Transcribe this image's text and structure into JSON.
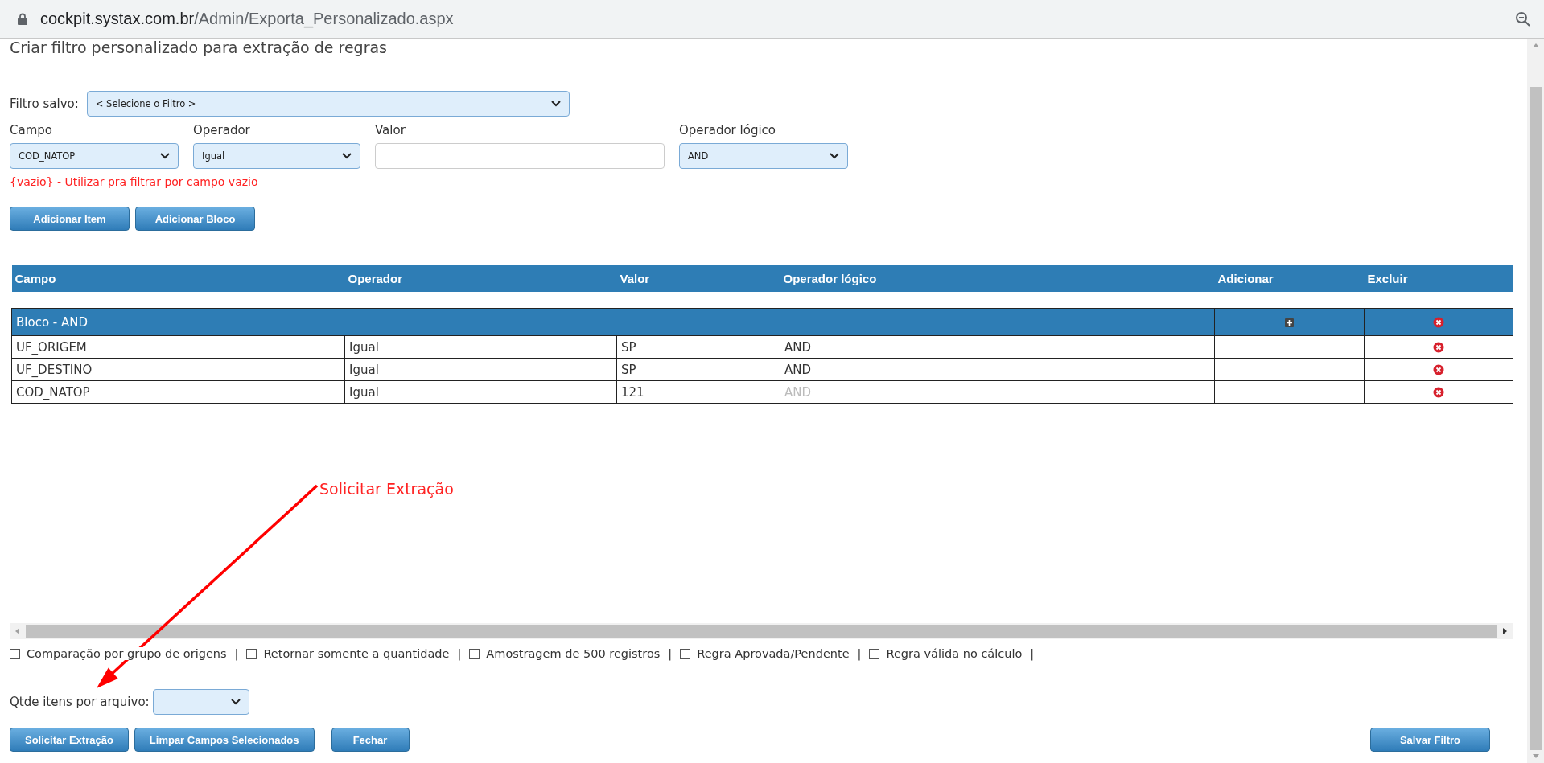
{
  "browser": {
    "url_host": "cockpit.systax.com.br",
    "url_path": "/Admin/Exporta_Personalizado.aspx"
  },
  "title": "Criar filtro personalizado para extração de regras",
  "saved_filter": {
    "label": "Filtro salvo:",
    "value": "< Selecione o Filtro >"
  },
  "fields": [
    {
      "kind": "select",
      "label": "Campo",
      "value": "COD_NATOP"
    },
    {
      "kind": "select",
      "label": "Operador",
      "value": "Igual"
    },
    {
      "kind": "input",
      "label": "Valor"
    },
    {
      "kind": "select",
      "label": "Operador lógico",
      "value": "AND"
    }
  ],
  "hint": "{vazio} - Utilizar pra filtrar por campo vazio",
  "add_buttons": [
    "Adicionar Item",
    "Adicionar Bloco"
  ],
  "table": {
    "columns": [
      "Campo",
      "Operador",
      "Valor",
      "Operador lógico",
      "Adicionar",
      "Excluir"
    ],
    "block": {
      "label": "Bloco - AND"
    },
    "rows": [
      {
        "campo": "UF_ORIGEM",
        "operador": "Igual",
        "valor": "SP",
        "logico": "AND",
        "logico_disabled": false
      },
      {
        "campo": "UF_DESTINO",
        "operador": "Igual",
        "valor": "SP",
        "logico": "AND",
        "logico_disabled": false
      },
      {
        "campo": "COD_NATOP",
        "operador": "Igual",
        "valor": "121",
        "logico": "AND",
        "logico_disabled": true
      }
    ]
  },
  "annotation": "Solicitar Extração",
  "options": [
    {
      "label": "Comparação por grupo de origens",
      "checked": false,
      "separator": "|"
    },
    {
      "label": "Retornar somente a quantidade",
      "checked": false,
      "separator": "|"
    },
    {
      "label": "Amostragem de 500 registros",
      "checked": false,
      "separator": "|"
    },
    {
      "label": "Regra Aprovada/Pendente",
      "checked": false,
      "separator": "|"
    },
    {
      "label": "Regra válida no cálculo",
      "checked": false,
      "separator": "|"
    }
  ],
  "items_per_file": {
    "label": "Qtde itens por arquivo:"
  },
  "actions": [
    "Solicitar Extração",
    "Limpar Campos Selecionados",
    "Fechar"
  ],
  "save_button": "Salvar Filtro"
}
